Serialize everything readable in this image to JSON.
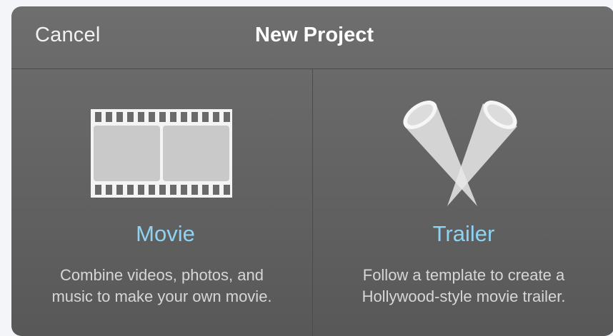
{
  "dialog": {
    "cancel_label": "Cancel",
    "title": "New Project"
  },
  "options": [
    {
      "label": "Movie",
      "description_line1": "Combine videos, photos, and",
      "description_line2": "music to make your own movie.",
      "icon": "film-strip-icon"
    },
    {
      "label": "Trailer",
      "description_line1": "Follow a template to create a",
      "description_line2": "Hollywood-style movie trailer.",
      "icon": "spotlights-icon"
    }
  ],
  "colors": {
    "accent": "#8fd3f2",
    "sheet": "#666666",
    "text": "#ffffff"
  }
}
